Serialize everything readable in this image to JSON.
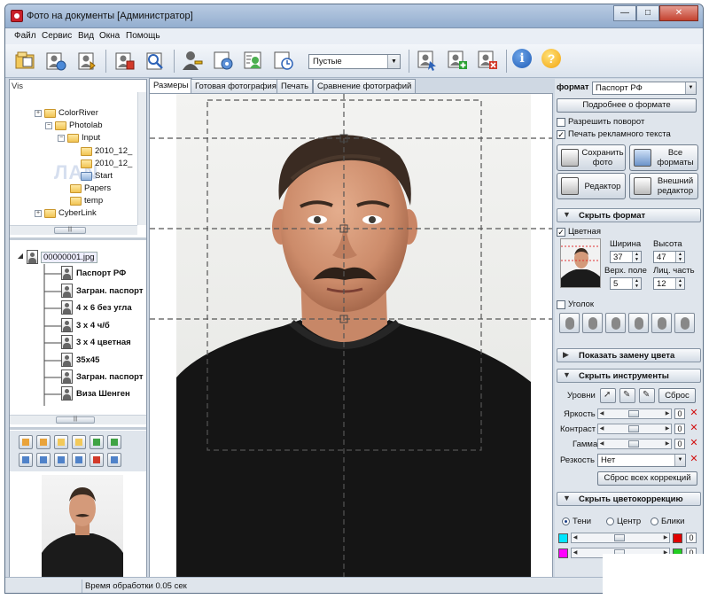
{
  "window": {
    "title": "Фото на документы [Администратор]",
    "controls": [
      "—",
      "□",
      "✕"
    ]
  },
  "menu": [
    "Файл",
    "Сервис",
    "Вид",
    "Окна",
    "Помощь"
  ],
  "toolbar": {
    "preset_select": "Пустые"
  },
  "folder_tree": {
    "tab_label": "Vis",
    "items": [
      {
        "label": "ColorRiver",
        "level": 1
      },
      {
        "label": "Photolab",
        "level": 2
      },
      {
        "label": "Input",
        "level": 3
      },
      {
        "label": "2010_12_",
        "level": 4
      },
      {
        "label": "2010_12_",
        "level": 4
      },
      {
        "label": "Start",
        "level": 4
      },
      {
        "label": "Papers",
        "level": 3
      },
      {
        "label": "temp",
        "level": 3
      },
      {
        "label": "CyberLink",
        "level": 1
      }
    ]
  },
  "preset_tree": {
    "root": "00000001.jpg",
    "items": [
      "Паспорт РФ",
      "Загран. паспорт",
      "4 х 6 без угла",
      "3 х 4 ч/б",
      "3 х 4 цветная",
      "35x45",
      "Загран. паспорт",
      "Виза Шенген"
    ]
  },
  "tabs": [
    "Размеры",
    "Готовая фотография",
    "Печать",
    "Сравнение фотографий"
  ],
  "format_panel": {
    "format_label": "формат",
    "format_value": "Паспорт РФ",
    "details_button": "Подробнее о формате",
    "allow_rotation": "Разрешить поворот",
    "allow_rotation_checked": false,
    "print_ad": "Печать рекламного текста",
    "print_ad_checked": true,
    "save_photo": "Сохранить фото",
    "all_formats": "Все форматы",
    "editor": "Редактор",
    "external_editor": "Внешний редактор"
  },
  "hide_format": {
    "header": "Скрыть формат",
    "color_label": "Цветная",
    "color_checked": true,
    "width_label": "Ширина",
    "width_value": "37",
    "height_label": "Высота",
    "height_value": "47",
    "top_margin_label": "Верх. поле",
    "top_margin_value": "5",
    "face_part_label": "Лиц. часть",
    "face_part_value": "12",
    "corner_label": "Уголок",
    "corner_checked": false
  },
  "show_color_replace": {
    "header": "Показать замену цвета"
  },
  "tools": {
    "header": "Скрыть инструменты",
    "levels_label": "Уровни",
    "reset_label": "Сброс",
    "brightness_label": "Яркость",
    "brightness_value": "0",
    "contrast_label": "Контраст",
    "contrast_value": "0",
    "gamma_label": "Гамма",
    "gamma_value": "0",
    "sharpness_label": "Резкость",
    "sharpness_value": "Нет",
    "reset_all": "Сброс всех коррекций"
  },
  "color_correction": {
    "header": "Скрыть цветокоррекцию",
    "shadows": "Тени",
    "center": "Центр",
    "highlights": "Блики",
    "selected": "Тени",
    "rows": [
      {
        "left": "#00e5ff",
        "right": "#e00000",
        "value": "0"
      },
      {
        "left": "#ff00ff",
        "right": "#22cc22",
        "value": "0"
      }
    ]
  },
  "status": {
    "text": "Время обработки 0.05 сек"
  },
  "colors": {
    "accent": "#1d5bb7",
    "chrome": "#cfd8e3",
    "panel": "#dfe5ec"
  }
}
